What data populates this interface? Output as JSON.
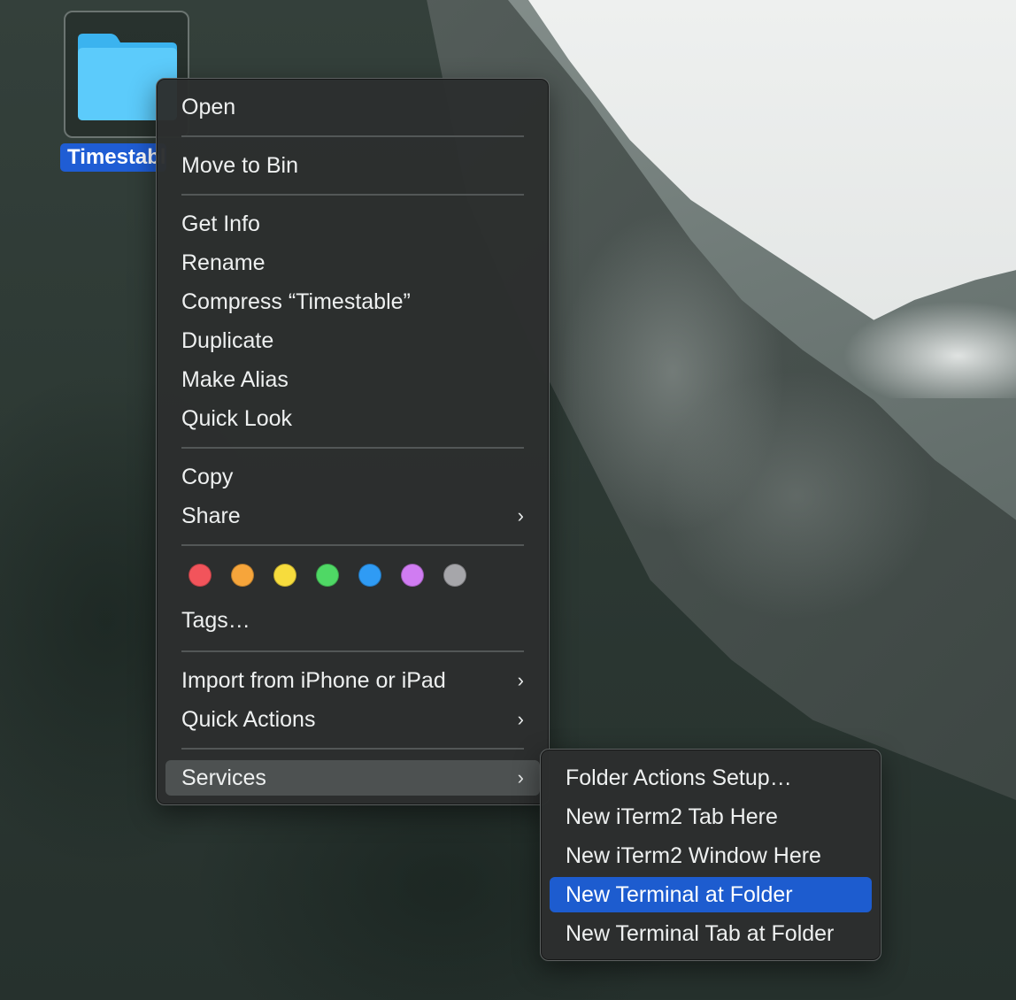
{
  "desktop": {
    "folder_label": "Timestable"
  },
  "context_menu": {
    "open": "Open",
    "move_to_bin": "Move to Bin",
    "get_info": "Get Info",
    "rename": "Rename",
    "compress": "Compress “Timestable”",
    "duplicate": "Duplicate",
    "make_alias": "Make Alias",
    "quick_look": "Quick Look",
    "copy": "Copy",
    "share": "Share",
    "tags": "Tags…",
    "import_from_iphone": "Import from iPhone or iPad",
    "quick_actions": "Quick Actions",
    "services": "Services",
    "submenu_chevron": "›"
  },
  "tag_colors": [
    {
      "name": "red",
      "color": "#f2545b"
    },
    {
      "name": "orange",
      "color": "#f6a53b"
    },
    {
      "name": "yellow",
      "color": "#f7dc3d"
    },
    {
      "name": "green",
      "color": "#4fd865"
    },
    {
      "name": "blue",
      "color": "#2f9bf4"
    },
    {
      "name": "purple",
      "color": "#d07cf2"
    },
    {
      "name": "gray",
      "color": "#a6a6aa"
    }
  ],
  "services_menu": {
    "items": [
      "Folder Actions Setup…",
      "New iTerm2 Tab Here",
      "New iTerm2 Window Here",
      "New Terminal at Folder",
      "New Terminal Tab at Folder"
    ],
    "selected_index": 3
  },
  "colors": {
    "selection_blue": "#1d5ccf",
    "folder_blue": "#4fc3f7"
  }
}
